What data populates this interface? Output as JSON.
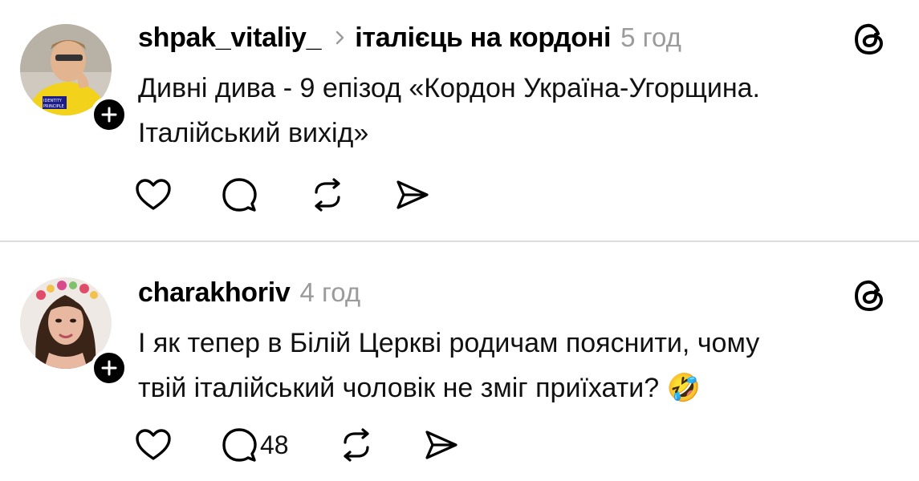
{
  "posts": [
    {
      "username": "shpak_vitaliy_",
      "topic": "італієць на кордоні",
      "time": "5 год",
      "line1": "Дивні дива - 9 епізод «Кордон Україна-Угорщина.",
      "line2": "Італійський вихід»",
      "reply_count": "",
      "avatar_badge_text": "IDENTITY PRINCIPLE",
      "icons": [
        "heart-icon",
        "comment-icon",
        "repost-icon",
        "share-icon",
        "threads-logo-icon",
        "plus-icon",
        "chevron-right-icon"
      ]
    },
    {
      "username": "charakhoriv",
      "time": "4 год",
      "line1": "І як тепер в Білій Церкві родичам пояснити, чому",
      "line2": "твій італійський чоловік не зміг приїхати? 🤣",
      "reply_count": "48",
      "icons": [
        "heart-icon",
        "comment-icon",
        "repost-icon",
        "share-icon",
        "threads-logo-icon",
        "plus-icon"
      ]
    }
  ],
  "colors": {
    "text": "#111111",
    "muted": "#9b9b9b",
    "divider": "#dcdcdc",
    "avatar1_shirt": "#f2d21b"
  }
}
